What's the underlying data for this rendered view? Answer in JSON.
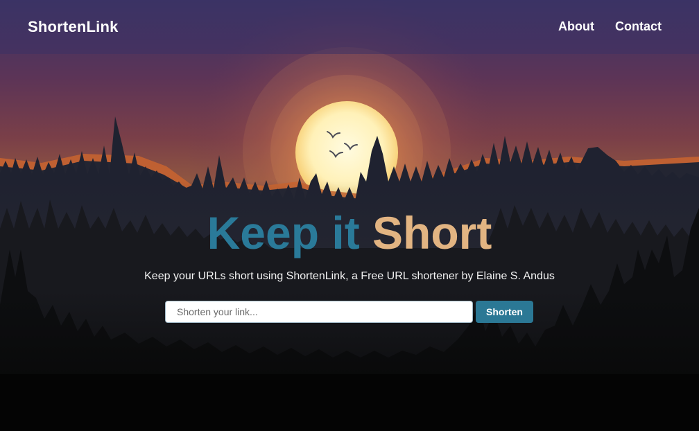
{
  "header": {
    "brand": "ShortenLink",
    "nav": {
      "about": "About",
      "contact": "Contact"
    }
  },
  "hero": {
    "title_part1": "Keep it",
    "title_part2": "Short",
    "subtitle": "Keep your URLs short using ShortenLink, a Free URL shortener by Elaine S. Andus"
  },
  "form": {
    "input_value": "",
    "input_placeholder": "Shorten your link...",
    "button_label": "Shorten"
  },
  "colors": {
    "accent_blue": "#2a7a99",
    "accent_gold": "#e2b482",
    "button_bg": "#2b7895"
  }
}
